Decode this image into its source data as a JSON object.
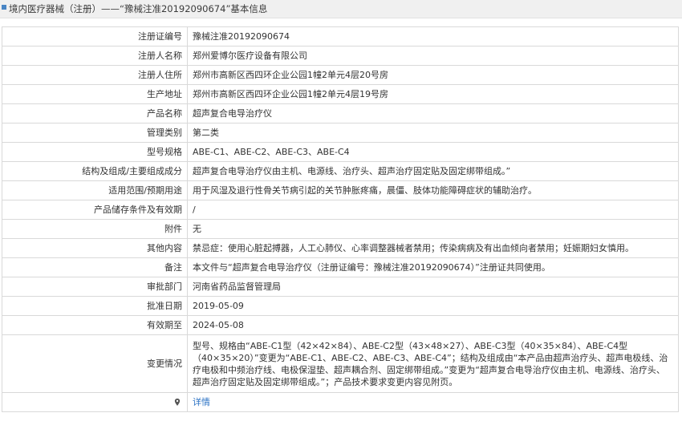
{
  "header": {
    "title": "境内医疗器械（注册）——“豫械注准20192090674”基本信息"
  },
  "rows": [
    {
      "label": "注册证编号",
      "value": "豫械注准20192090674"
    },
    {
      "label": "注册人名称",
      "value": "郑州爱博尔医疗设备有限公司"
    },
    {
      "label": "注册人住所",
      "value": "郑州市高新区西四环企业公园1幢2单元4层20号房"
    },
    {
      "label": "生产地址",
      "value": "郑州市高新区西四环企业公园1幢2单元4层19号房"
    },
    {
      "label": "产品名称",
      "value": "超声复合电导治疗仪"
    },
    {
      "label": "管理类别",
      "value": "第二类"
    },
    {
      "label": "型号规格",
      "value": "ABE-C1、ABE-C2、ABE-C3、ABE-C4"
    },
    {
      "label": "结构及组成/主要组成成分",
      "value": "超声复合电导治疗仪由主机、电源线、治疗头、超声治疗固定贴及固定绑带组成。”"
    },
    {
      "label": "适用范围/预期用途",
      "value": "用于风湿及退行性骨关节病引起的关节肿胀疼痛，晨僵、肢体功能障碍症状的辅助治疗。"
    },
    {
      "label": "产品储存条件及有效期",
      "value": "/"
    },
    {
      "label": "附件",
      "value": "无"
    },
    {
      "label": "其他内容",
      "value": "禁忌症：使用心脏起搏器，人工心肺仪、心率调整器械者禁用；传染病病及有出血倾向者禁用；妊娠期妇女慎用。"
    },
    {
      "label": "备注",
      "value": "本文件与“超声复合电导治疗仪（注册证编号：豫械注准20192090674）”注册证共同使用。"
    },
    {
      "label": "审批部门",
      "value": "河南省药品监督管理局"
    },
    {
      "label": "批准日期",
      "value": "2019-05-09"
    },
    {
      "label": "有效期至",
      "value": "2024-05-08"
    },
    {
      "label": "变更情况",
      "value": "型号、规格由“ABE-C1型（42×42×84）、ABE-C2型（43×48×27）、ABE-C3型（40×35×84）、ABE-C4型（40×35×20）”变更为“ABE-C1、ABE-C2、ABE-C3、ABE-C4”；结构及组成由“本产品由超声治疗头、超声电极线、治疗电极和中频治疗线、电极保湿垫、超声耦合剂、固定绑带组成。”变更为“超声复合电导治疗仪由主机、电源线、治疗头、超声治疗固定贴及固定绑带组成。”；产品技术要求变更内容见附页。"
    }
  ],
  "detail": {
    "icon": "pin-icon",
    "link_label": "详情"
  }
}
